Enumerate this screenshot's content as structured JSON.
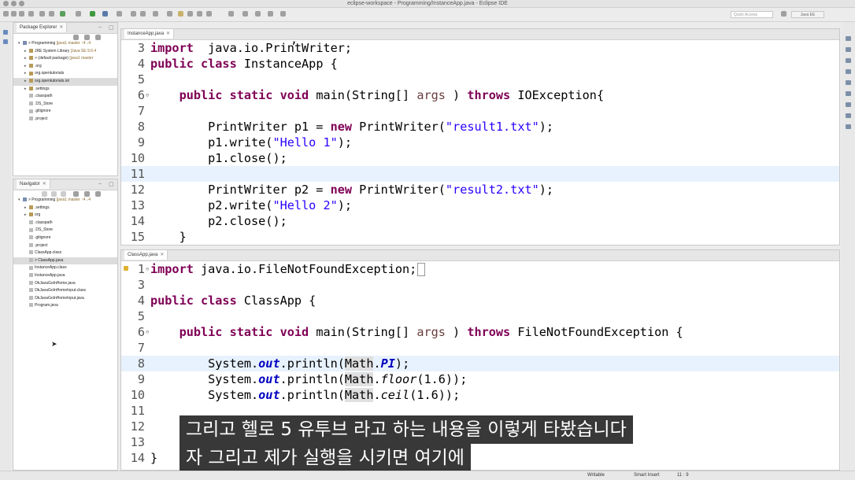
{
  "window": {
    "title": "eclipse-workspace - Programming/InstanceApp.java - Eclipse IDE"
  },
  "toolbar": {
    "quick_access_placeholder": "Quick Access",
    "perspective": "Java EE"
  },
  "package_explorer": {
    "title": "Package Explorer",
    "items": [
      {
        "arrow": "▾",
        "label": "> Programming",
        "deco": " [java1 master ↑4 ↓4",
        "indent": 0,
        "kind": "proj"
      },
      {
        "arrow": "▸",
        "label": "JRE System Library",
        "deco": " [Java SE 9.0.4",
        "indent": 1,
        "kind": "lib"
      },
      {
        "arrow": "▸",
        "label": "> (default package)",
        "deco": " [java1 master",
        "indent": 1,
        "kind": "pkg"
      },
      {
        "arrow": "▸",
        "label": ".org",
        "deco": "",
        "indent": 1,
        "kind": "pkg"
      },
      {
        "arrow": "▸",
        "label": "org.opentutorials",
        "deco": "",
        "indent": 1,
        "kind": "pkg"
      },
      {
        "arrow": "▸",
        "label": "org.opentutorials.iot",
        "deco": "",
        "indent": 1,
        "kind": "pkg",
        "selected": true
      },
      {
        "arrow": "▸",
        "label": ".settings",
        "deco": "",
        "indent": 1,
        "kind": "pkg"
      },
      {
        "arrow": "",
        "label": ".classpath",
        "deco": "",
        "indent": 1,
        "kind": "file"
      },
      {
        "arrow": "",
        "label": ".DS_Store",
        "deco": "",
        "indent": 1,
        "kind": "file"
      },
      {
        "arrow": "",
        "label": ".gitignore",
        "deco": "",
        "indent": 1,
        "kind": "file"
      },
      {
        "arrow": "",
        "label": ".project",
        "deco": "",
        "indent": 1,
        "kind": "file"
      }
    ]
  },
  "navigator": {
    "title": "Navigator",
    "items": [
      {
        "arrow": "▾",
        "label": "> Programming",
        "deco": " [java1 master ↑4 ↓4",
        "indent": 0,
        "kind": "proj"
      },
      {
        "arrow": "▸",
        "label": ".settings",
        "deco": "",
        "indent": 1,
        "kind": "pkg"
      },
      {
        "arrow": "▸",
        "label": "org",
        "deco": "",
        "indent": 1,
        "kind": "pkg"
      },
      {
        "arrow": "",
        "label": ".classpath",
        "deco": "",
        "indent": 1,
        "kind": "file"
      },
      {
        "arrow": "",
        "label": ".DS_Store",
        "deco": "",
        "indent": 1,
        "kind": "file"
      },
      {
        "arrow": "",
        "label": ".gitignore",
        "deco": "",
        "indent": 1,
        "kind": "file"
      },
      {
        "arrow": "",
        "label": ".project",
        "deco": "",
        "indent": 1,
        "kind": "file"
      },
      {
        "arrow": "",
        "label": "ClassApp.class",
        "deco": "",
        "indent": 1,
        "kind": "file"
      },
      {
        "arrow": "",
        "label": "> ClassApp.java",
        "deco": "",
        "indent": 1,
        "kind": "file",
        "selected": true
      },
      {
        "arrow": "",
        "label": "InstanceApp.class",
        "deco": "",
        "indent": 1,
        "kind": "file"
      },
      {
        "arrow": "",
        "label": "InstanceApp.java",
        "deco": "",
        "indent": 1,
        "kind": "file"
      },
      {
        "arrow": "",
        "label": "OkJavaGoInHome.java",
        "deco": "",
        "indent": 1,
        "kind": "file"
      },
      {
        "arrow": "",
        "label": "OkJavaGoInHomeInput.class",
        "deco": "",
        "indent": 1,
        "kind": "file"
      },
      {
        "arrow": "",
        "label": "OkJavaGoInHomeInput.java",
        "deco": "",
        "indent": 1,
        "kind": "file"
      },
      {
        "arrow": "",
        "label": "Program.java",
        "deco": "",
        "indent": 1,
        "kind": "file"
      }
    ]
  },
  "editor_top": {
    "tab": "InstanceApp.java",
    "highlight_line": 11,
    "lines": [
      {
        "n": "3",
        "fold": "",
        "tokens": [
          [
            "kw",
            "import"
          ],
          [
            "",
            "  java.io.PrintWriter;"
          ]
        ]
      },
      {
        "n": "4",
        "fold": "",
        "tokens": [
          [
            "kw",
            "public class"
          ],
          [
            "",
            " InstanceApp {"
          ]
        ]
      },
      {
        "n": "5",
        "fold": "",
        "tokens": []
      },
      {
        "n": "6",
        "fold": "⊖",
        "tokens": [
          [
            "",
            "    "
          ],
          [
            "kw",
            "public static void"
          ],
          [
            "",
            " main(String[] "
          ],
          [
            "param",
            "args"
          ],
          [
            "",
            " ) "
          ],
          [
            "kw",
            "throws"
          ],
          [
            "",
            " IOException{"
          ]
        ]
      },
      {
        "n": "7",
        "fold": "",
        "tokens": []
      },
      {
        "n": "8",
        "fold": "",
        "tokens": [
          [
            "",
            "        PrintWriter p1 = "
          ],
          [
            "kw",
            "new"
          ],
          [
            "",
            " PrintWriter("
          ],
          [
            "str",
            "\"result1.txt\""
          ],
          [
            "",
            ");"
          ]
        ]
      },
      {
        "n": "9",
        "fold": "",
        "tokens": [
          [
            "",
            "        p1.write("
          ],
          [
            "str",
            "\"Hello 1\""
          ],
          [
            "",
            ");"
          ]
        ]
      },
      {
        "n": "10",
        "fold": "",
        "tokens": [
          [
            "",
            "        p1.close();"
          ]
        ]
      },
      {
        "n": "11",
        "fold": "",
        "tokens": []
      },
      {
        "n": "12",
        "fold": "",
        "tokens": [
          [
            "",
            "        PrintWriter p2 = "
          ],
          [
            "kw",
            "new"
          ],
          [
            "",
            " PrintWriter("
          ],
          [
            "str",
            "\"result2.txt\""
          ],
          [
            "",
            ");"
          ]
        ]
      },
      {
        "n": "13",
        "fold": "",
        "tokens": [
          [
            "",
            "        p2.write("
          ],
          [
            "str",
            "\"Hello 2\""
          ],
          [
            "",
            ");"
          ]
        ]
      },
      {
        "n": "14",
        "fold": "",
        "tokens": [
          [
            "",
            "        p2.close();"
          ]
        ]
      },
      {
        "n": "15",
        "fold": "",
        "tokens": [
          [
            "",
            "    }"
          ]
        ]
      }
    ]
  },
  "editor_bottom": {
    "tab": "ClassApp.java",
    "highlight_line": 8,
    "lines": [
      {
        "n": "1",
        "fold": "⊖",
        "tokens": [
          [
            "kw",
            "import"
          ],
          [
            "",
            " java.io.FileNotFoundException;"
          ],
          [
            "cursor",
            ""
          ]
        ]
      },
      {
        "n": "3",
        "fold": "",
        "tokens": []
      },
      {
        "n": "4",
        "fold": "",
        "tokens": [
          [
            "kw",
            "public class"
          ],
          [
            "",
            " ClassApp {"
          ]
        ]
      },
      {
        "n": "5",
        "fold": "",
        "tokens": []
      },
      {
        "n": "6",
        "fold": "⊖",
        "tokens": [
          [
            "",
            "    "
          ],
          [
            "kw",
            "public static void"
          ],
          [
            "",
            " main(String[] "
          ],
          [
            "param",
            "args"
          ],
          [
            "",
            " ) "
          ],
          [
            "kw",
            "throws"
          ],
          [
            "",
            " FileNotFoundException {"
          ]
        ]
      },
      {
        "n": "7",
        "fold": "",
        "tokens": []
      },
      {
        "n": "8",
        "fold": "",
        "tokens": [
          [
            "",
            "        System."
          ],
          [
            "stat",
            "out"
          ],
          [
            "",
            ".println("
          ],
          [
            "occ",
            "Math"
          ],
          [
            "",
            "."
          ],
          [
            "stat",
            "PI"
          ],
          [
            "",
            ");"
          ]
        ]
      },
      {
        "n": "9",
        "fold": "",
        "tokens": [
          [
            "",
            "        System."
          ],
          [
            "stat",
            "out"
          ],
          [
            "",
            ".println("
          ],
          [
            "occ",
            "Math"
          ],
          [
            "",
            "."
          ],
          [
            "ital",
            "floor"
          ],
          [
            "",
            "(1.6));"
          ]
        ]
      },
      {
        "n": "10",
        "fold": "",
        "tokens": [
          [
            "",
            "        System."
          ],
          [
            "stat",
            "out"
          ],
          [
            "",
            ".println("
          ],
          [
            "occ",
            "Math"
          ],
          [
            "",
            "."
          ],
          [
            "ital",
            "ceil"
          ],
          [
            "",
            "(1.6));"
          ]
        ]
      },
      {
        "n": "11",
        "fold": "",
        "tokens": []
      },
      {
        "n": "12",
        "fold": "",
        "tokens": []
      },
      {
        "n": "13",
        "fold": "",
        "tokens": []
      },
      {
        "n": "14",
        "fold": "",
        "tokens": [
          [
            "",
            "}"
          ]
        ]
      }
    ]
  },
  "subtitles": [
    "그리고 헬로 5 유투브 라고 하는 내용을 이렇게 타봤습니다",
    "자 그리고 제가 실행을 시키면 여기에"
  ],
  "status": {
    "writable": "Writable",
    "insert_mode": "Smart Insert",
    "position": "11 : 9"
  }
}
